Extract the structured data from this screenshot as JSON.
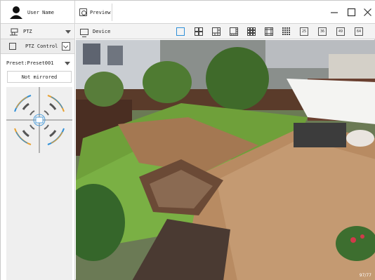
{
  "user": {
    "name": "User Name"
  },
  "tabs": [
    {
      "label": "Preview"
    }
  ],
  "sidebar": {
    "ptz_label": "PTZ",
    "ptz_control_label": "PTZ Control",
    "preset": "Preset:Preset001",
    "mirror": "Not mirrored"
  },
  "toolbar": {
    "device_label": "Device",
    "layout_labels": [
      "25",
      "36",
      "49",
      "64"
    ]
  },
  "video": {
    "stamp_text": "97/77"
  }
}
